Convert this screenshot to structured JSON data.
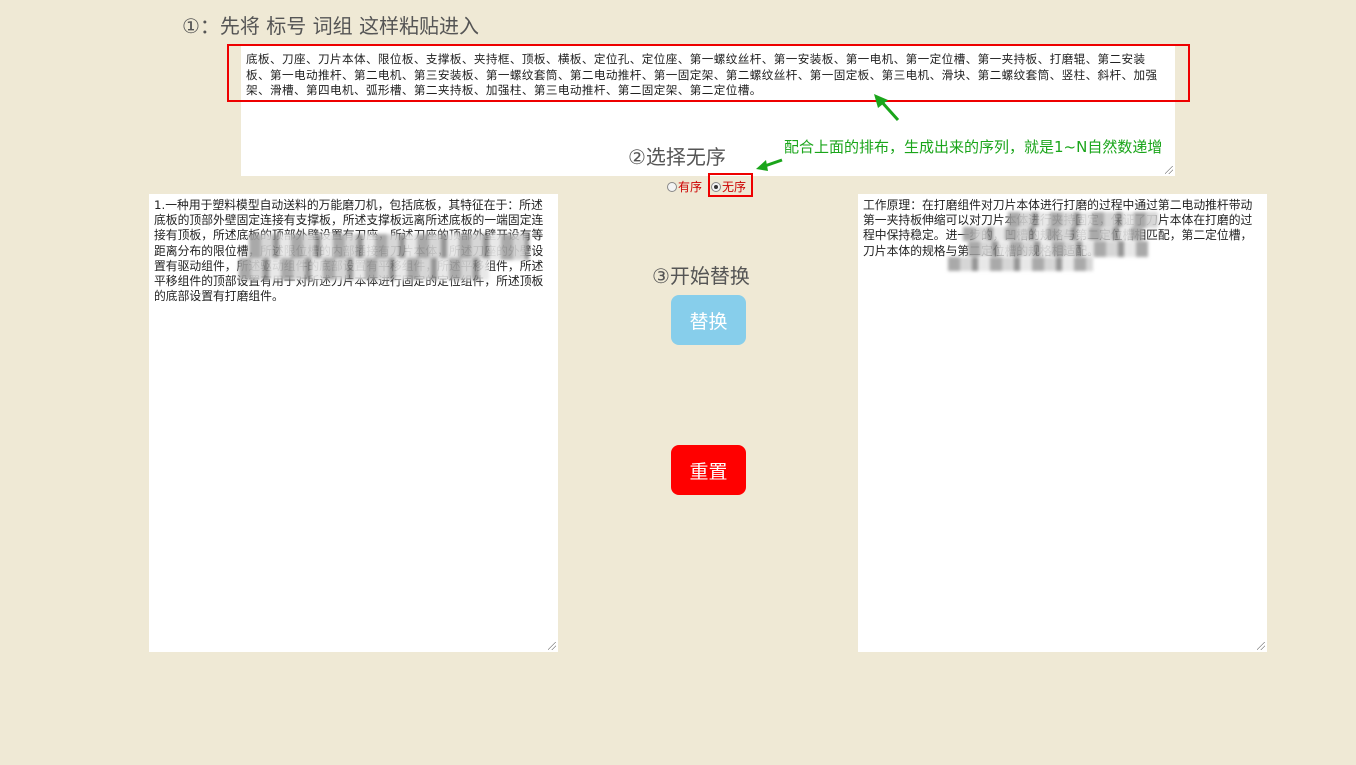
{
  "step1": {
    "label": "①：先将 标号 词组 这样粘贴进入"
  },
  "top_input": {
    "value": "底板、刀座、刀片本体、限位板、支撑板、夹持框、顶板、横板、定位孔、定位座、第一螺纹丝杆、第一安装板、第一电机、第一定位槽、第一夹持板、打磨辊、第二安装板、第一电动推杆、第二电机、第三安装板、第一螺纹套筒、第二电动推杆、第一固定架、第二螺纹丝杆、第一固定板、第三电机、滑块、第二螺纹套筒、竖柱、斜杆、加强架、滑槽、第四电机、弧形槽、第二夹持板、加强柱、第三电动推杆、第二固定架、第二定位槽。"
  },
  "step2": {
    "label": "②选择无序"
  },
  "annotation": {
    "text": "配合上面的排布，生成出来的序列，就是1~N自然数递增"
  },
  "order_options": {
    "ordered": {
      "label": "有序",
      "checked": false
    },
    "unordered": {
      "label": "无序",
      "checked": true
    }
  },
  "step3": {
    "label": "③开始替换"
  },
  "buttons": {
    "replace": "替换",
    "reset": "重置"
  },
  "left_input": {
    "value": "1.一种用于塑料模型自动送料的万能磨刀机，包括底板，其特征在于：所述底板的顶部外壁固定连接有支撑板，所述支撑板远离所述底板的一端固定连接有顶板，所述底板的顶部外壁设置有刀座，所述刀座的顶部外壁开设有等距离分布的限位槽，所述限位槽的内部插接有刀片本体，所述刀座的外壁设置有驱动组件，所述驱动组件的底部设置有平移组件，所述平移组件，所述平移组件的顶部设置有用于对所述刀片本体进行固定的定位组件，所述顶板的底部设置有打磨组件。"
  },
  "right_input": {
    "value": "工作原理：在打磨组件对刀片本体进行打磨的过程中通过第二电动推杆带动第一夹持板伸缩可以对刀片本体进行夹持固定，保证了刀片本体在打磨的过程中保持稳定。进一步的，凹槽的规格与第二定位槽相匹配，第二定位槽，刀片本体的规格与第二定位槽的规格相适配。"
  },
  "colors": {
    "background": "#efe9d5",
    "highlight": "#ee0000",
    "annotation": "#1aa51a",
    "replace_button": "#87ceeb",
    "reset_button": "#ff0000"
  }
}
